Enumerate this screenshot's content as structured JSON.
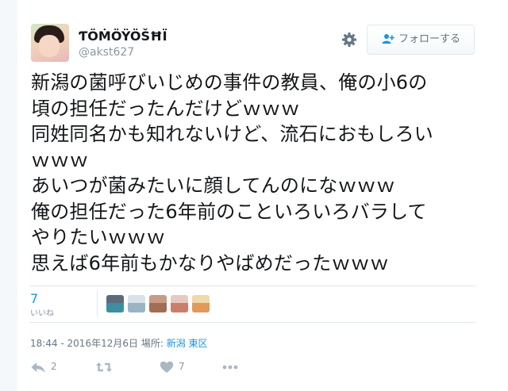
{
  "user": {
    "name": "ƬÖṀÖŸÖŠĦÏ",
    "handle": "@akst627"
  },
  "header": {
    "follow_label": "フォローする",
    "settings_icon": "gear-icon",
    "follow_icon": "user-plus-icon"
  },
  "tweet": {
    "text": "新潟の菌呼びいじめの事件の教員、俺の小6の\n頃の担任だったんだけどｗｗｗ\n同姓同名かも知れないけど、流石におもしろい\nｗｗｗ\nあいつが菌みたいに顔してんのになｗｗｗ\n俺の担任だった6年前のこといろいろバラして\nやりたいｗｗｗ\n思えば6年前もかなりやばめだったｗｗｗ"
  },
  "stats": {
    "likes_count": "7",
    "likes_label": "いいね"
  },
  "meta": {
    "timestamp": "18:44 - 2016年12月6日",
    "location_prefix": "場所:",
    "location_link": "新潟 東区"
  },
  "actions": {
    "reply_count": "2",
    "retweet_count": "",
    "like_count": "7"
  },
  "colors": {
    "accent": "#1b95e0",
    "text": "#14171a",
    "muted": "#657786",
    "icon": "#aab8c2",
    "divider": "#e1e8ed"
  }
}
